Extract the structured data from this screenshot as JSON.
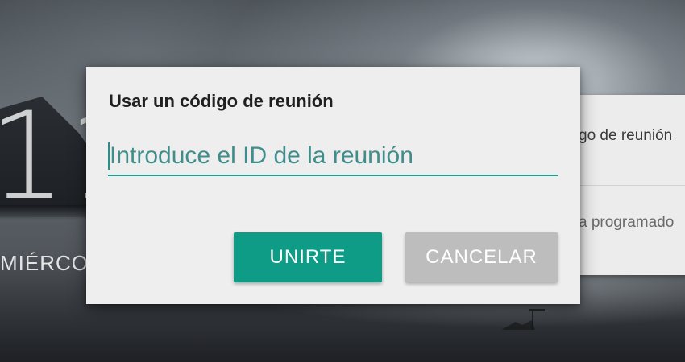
{
  "background": {
    "clock_digits": "11",
    "day_label": "MIÉRCO",
    "card": {
      "row_one": "go de reunión",
      "row_two": "a programado"
    }
  },
  "dialog": {
    "title": "Usar un código de reunión",
    "input": {
      "value": "",
      "placeholder": "Introduce el ID de la reunión"
    },
    "join_label": "UNIRTE",
    "cancel_label": "CANCELAR"
  },
  "colors": {
    "accent": "#0f9c87",
    "cancel_button": "#bdbdbd",
    "dialog_bg": "#eeeeee"
  }
}
